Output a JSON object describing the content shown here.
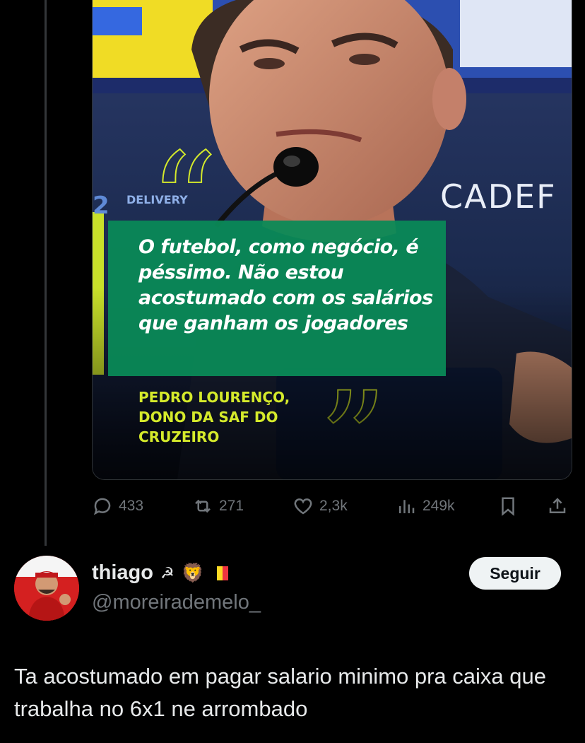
{
  "tweet_media": {
    "quote_text": "O futebol, como negócio, é péssimo. Não estou acostumado com os salários que ganham os jogadores",
    "attribution": "PEDRO LOURENÇO,\nDONO DA SAF DO\nCRUZEIRO",
    "background_sign_text": "CADEF",
    "sponsor_text": "DELIVERY",
    "quote_color": "#0a8a57",
    "accent_color": "#d5ea2b"
  },
  "actions": {
    "replies": "433",
    "retweets": "271",
    "likes": "2,3k",
    "views": "249k"
  },
  "reply": {
    "display_name": "thiago",
    "badges": [
      "☭",
      "🦁",
      "flag-belgium"
    ],
    "handle": "@moreirademelo_",
    "follow_label": "Seguir",
    "text": "Ta acostumado em pagar salario minimo pra caixa que trabalha no 6x1 ne arrombado"
  }
}
